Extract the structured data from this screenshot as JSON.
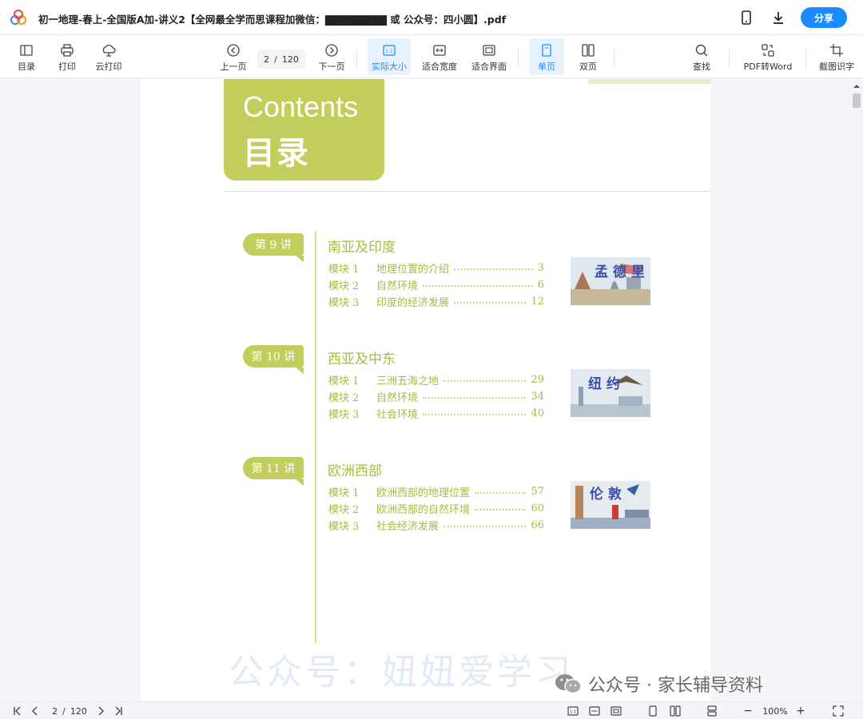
{
  "titlebar": {
    "title": "初一地理-春上-全国版A加-讲义2【全网最全学而思课程加微信：▇▇▇▇▇▇▇▇ 或 公众号：四小圆】.pdf",
    "share_label": "分享",
    "icons": [
      "app-logo-icon",
      "phone-icon",
      "download-icon"
    ]
  },
  "toolbar": {
    "toc_label": "目录",
    "print_label": "打印",
    "cloud_print_label": "云打印",
    "prev_label": "上一页",
    "current_page": "2",
    "page_sep": "/",
    "total_pages": "120",
    "next_label": "下一页",
    "actual_size_label": "实际大小",
    "fit_width_label": "适合宽度",
    "fit_page_label": "适合界面",
    "single_label": "单页",
    "double_label": "双页",
    "find_label": "查找",
    "pdf_word_label": "PDF转Word",
    "ocr_label": "截图识字"
  },
  "document": {
    "contents_en": "Contents",
    "contents_zh": "目录",
    "lectures": [
      {
        "tag": "第 9 讲",
        "title": "南亚及印度",
        "modules": [
          {
            "num": "模块 1",
            "name": "地理位置的介绍",
            "page": "3"
          },
          {
            "num": "模块 2",
            "name": "自然环境",
            "page": "6"
          },
          {
            "num": "模块 3",
            "name": "印度的经济发展",
            "page": "12"
          }
        ],
        "thumb_label": "孟 德 里"
      },
      {
        "tag": "第 10 讲",
        "title": "西亚及中东",
        "modules": [
          {
            "num": "模块 1",
            "name": "三洲五海之地",
            "page": "29"
          },
          {
            "num": "模块 2",
            "name": "自然环境",
            "page": "34"
          },
          {
            "num": "模块 3",
            "name": "社会环境",
            "page": "40"
          }
        ],
        "thumb_label": "纽 约"
      },
      {
        "tag": "第 11 讲",
        "title": "欧洲西部",
        "modules": [
          {
            "num": "模块 1",
            "name": "欧洲西部的地理位置",
            "page": "57"
          },
          {
            "num": "模块 2",
            "name": "欧洲西部的自然环境",
            "page": "60"
          },
          {
            "num": "模块 3",
            "name": "社会经济发展",
            "page": "66"
          }
        ],
        "thumb_label": "伦 敦"
      }
    ],
    "watermark": "公众号：妞妞爱学习",
    "wechat_mark": "公众号 · 家长辅导资料"
  },
  "statusbar": {
    "current_page": "2",
    "page_sep": "/",
    "total_pages": "120",
    "zoom": "100%",
    "zoom_minus": "−",
    "zoom_plus": "+"
  },
  "colors": {
    "accent": "#1a8cff",
    "olive": "#c2cd5c",
    "olive_text": "#aab844"
  }
}
